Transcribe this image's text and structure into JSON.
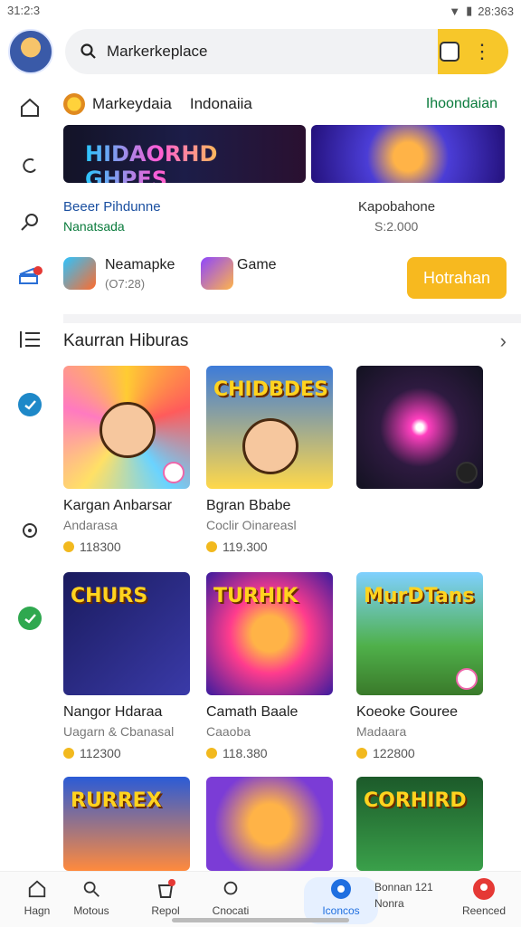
{
  "status": {
    "time": "31:2:3",
    "right_text": "28:363"
  },
  "search": {
    "value": "Markerkeplace"
  },
  "rail": {
    "icons": [
      "home-icon",
      "refresh-icon",
      "search-icon",
      "cart-icon",
      "list-icon",
      "check-icon",
      "camera-icon",
      "check-icon"
    ]
  },
  "header": {
    "title": "Markeydaia",
    "region": "Indonaiia",
    "right": "Ihoondaian"
  },
  "banners": {
    "left_text": "HIDAORHD GHPES"
  },
  "promos": {
    "left_line1": "Beeer Pihdunne",
    "left_line2": "Nanatsada",
    "right_line1": "Kapobahone",
    "right_line2": "S:2.000"
  },
  "apps": {
    "app1_name": "Neamapke",
    "app1_sub": "(O7:28)",
    "app2_name": "Game",
    "button_label": "Hotrahan"
  },
  "section": {
    "title": "Kaurran Hiburas"
  },
  "cards": [
    {
      "img_text": "",
      "name": "Kargan Anbarsar",
      "sub": "Andarasa",
      "price": "118300"
    },
    {
      "img_text": "CHIDBDES",
      "name": "Bgran Bbabe",
      "sub": "Coclir Oinareasl",
      "price": "119.300"
    },
    {
      "img_text": "",
      "name": "",
      "sub": "",
      "price": ""
    },
    {
      "img_text": "CHURS",
      "name": "Nangor Hdaraa",
      "sub": "Uagarn & Cbanasal",
      "price": "112300"
    },
    {
      "img_text": "TURHIK",
      "name": "Camath Baale",
      "sub": "Caaoba",
      "price": "118.380"
    },
    {
      "img_text": "MurDTans",
      "name": "Koeoke Gouree",
      "sub": "Madaara",
      "price": "122800"
    },
    {
      "img_text": "RURREX",
      "name": "",
      "sub": "",
      "price": ""
    },
    {
      "img_text": "",
      "name": "",
      "sub": "",
      "price": ""
    },
    {
      "img_text": "CORHIRD",
      "name": "",
      "sub": "",
      "price": ""
    }
  ],
  "bottom_nav": [
    {
      "label": "Hagn"
    },
    {
      "label": "Motous"
    },
    {
      "label": "Repol"
    },
    {
      "label": "Cnocati"
    },
    {
      "label": "Iconcos"
    },
    {
      "label": "Reenced"
    }
  ],
  "bottom_extra": {
    "text1": "Bonnan 121",
    "text2": "Nonra"
  },
  "colors": {
    "accent": "#f7c72a",
    "green": "#0a7b3c",
    "active": "#1f6fe0"
  }
}
